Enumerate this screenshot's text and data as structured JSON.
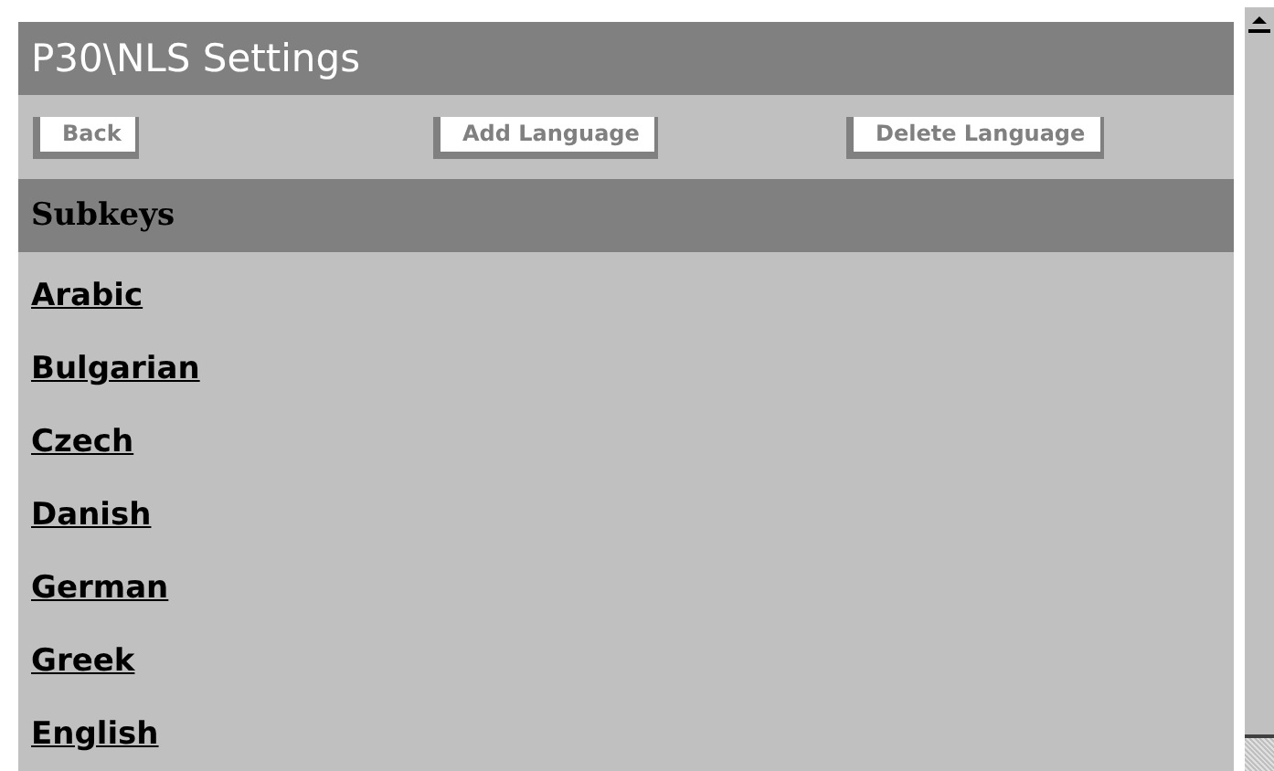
{
  "window": {
    "title": "P30\\NLS Settings"
  },
  "buttons": [
    "Back",
    "Add Language",
    "Delete Language"
  ],
  "table": {
    "header": "Subkeys",
    "rows": [
      "Arabic",
      "Bulgarian",
      "Czech",
      "Danish",
      "German",
      "Greek",
      "English"
    ]
  }
}
